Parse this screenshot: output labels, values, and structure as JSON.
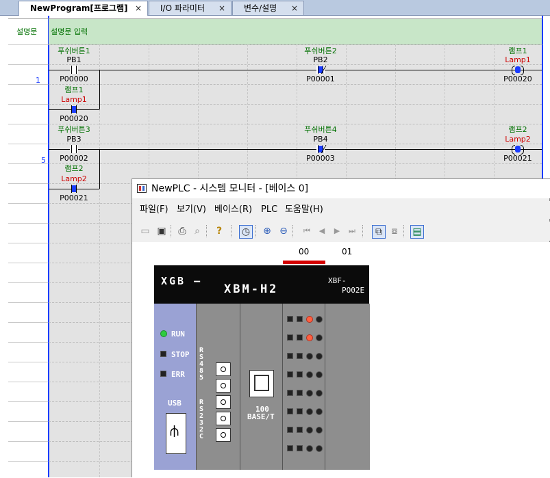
{
  "tabs": [
    {
      "label": "NewProgram[프로그램]",
      "close": "×"
    },
    {
      "label": "I/O 파라미터",
      "close": "×"
    },
    {
      "label": "변수/설명",
      "close": "×"
    }
  ],
  "ladder": {
    "comment_row_label": "설명문",
    "comment_placeholder": "설명문 입력",
    "rungs": [
      {
        "step": "1",
        "contacts": [
          {
            "comment": "푸쉬버튼1",
            "name": "PB1",
            "address": "P00000",
            "state": "no"
          },
          {
            "comment": "푸쉬버튼2",
            "name": "PB2",
            "address": "P00001",
            "state": "nc"
          }
        ],
        "branch": {
          "comment": "램프1",
          "name": "Lamp1",
          "address": "P00020"
        },
        "coil": {
          "comment": "램프1",
          "name": "Lamp1",
          "address": "P00020"
        }
      },
      {
        "step": "5",
        "contacts": [
          {
            "comment": "푸쉬버튼3",
            "name": "PB3",
            "address": "P00002",
            "state": "no"
          },
          {
            "comment": "푸쉬버튼4",
            "name": "PB4",
            "address": "P00003",
            "state": "nc"
          }
        ],
        "branch": {
          "comment": "램프2",
          "name": "Lamp2",
          "address": "P00021"
        },
        "coil": {
          "comment": "램프2",
          "name": "Lamp2",
          "address": "P00021"
        }
      }
    ]
  },
  "monitor": {
    "title": "NewPLC - 시스템 모니터 - [베이스 0]",
    "menus": [
      "파일(F)",
      "보기(V)",
      "베이스(R)",
      "PLC",
      "도움말(H)"
    ],
    "toolbar_icons": [
      "open-icon",
      "save-icon",
      "print-icon",
      "print-preview-icon",
      "help-icon",
      "monitor-icon",
      "zoom-in-icon",
      "zoom-out-icon",
      "first-icon",
      "prev-icon",
      "next-icon",
      "last-icon",
      "system-icon",
      "network-icon",
      "module-icon"
    ],
    "slots": [
      "00",
      "01"
    ],
    "plc": {
      "brand": "XGB —",
      "model": "XBM-H2",
      "module_name_line1": "XBF-",
      "module_name_line2": "PO02E",
      "leds": [
        "RUN",
        "STOP",
        "ERR"
      ],
      "usb_label": "USB",
      "port1": "RS485",
      "port2": "RS232C",
      "eth_line1": "100",
      "eth_line2": "BASE/T"
    }
  },
  "colors": {
    "comment_bg": "#c8e6c8",
    "active_contact": "#1a3cff",
    "coil_name": "#cc0000",
    "comment_text": "#007000"
  }
}
